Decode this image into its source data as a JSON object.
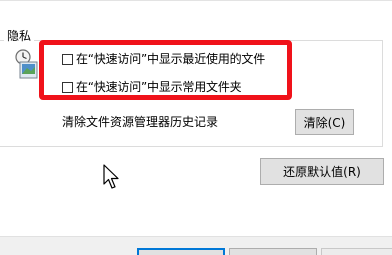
{
  "privacy_group": {
    "title": "隐私",
    "icon": "privacy-icon",
    "options": [
      {
        "label": "在“快速访问”中显示最近使用的文件",
        "checked": false
      },
      {
        "label": "在“快速访问”中显示常用文件夹",
        "checked": false
      }
    ],
    "clear_history_label": "清除文件资源管理器历史记录",
    "clear_button": "清除(C)"
  },
  "restore_button": "还原默认值(R)",
  "highlight_color": "#f0121a"
}
